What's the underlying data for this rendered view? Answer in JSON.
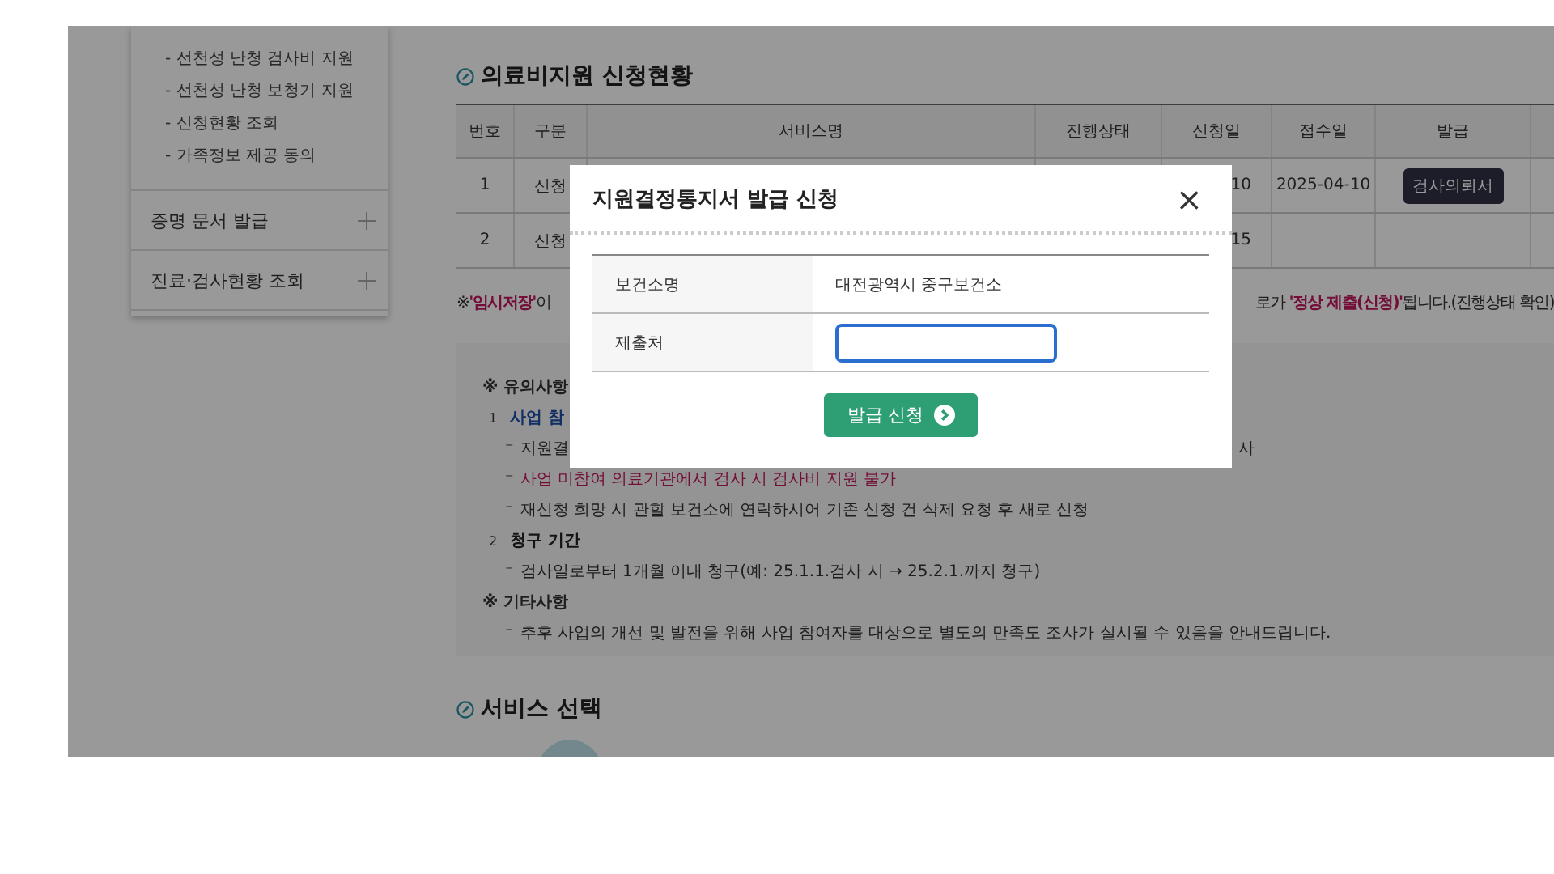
{
  "sidebar": {
    "sub_items": [
      "- 선천성 난청 검사비 지원",
      "- 선천성 난청 보청기 지원",
      "- 신청현황 조회",
      "- 가족정보 제공 동의"
    ],
    "sections": [
      {
        "label": "증명 문서 발급",
        "expanded": false
      },
      {
        "label": "진료·검사현황 조회",
        "expanded": false
      }
    ]
  },
  "status_section": {
    "title": "의료비지원 신청현황",
    "table": {
      "columns": [
        "번호",
        "구분",
        "서비스명",
        "진행상태",
        "신청일",
        "접수일",
        "발급"
      ],
      "rows": [
        {
          "cells": [
            "1",
            "신청",
            "",
            "",
            "10",
            "2025-04-10"
          ],
          "action": "검사의뢰서"
        },
        {
          "cells": [
            "2",
            "신청",
            "",
            "",
            "15",
            "",
            ""
          ]
        }
      ]
    },
    "notice_left": [
      {
        "text": "※",
        "em": false
      },
      {
        "text": "'임시저장'",
        "em": true
      },
      {
        "text": "이",
        "em": false
      }
    ],
    "notice_right": [
      {
        "text": "로가 ",
        "em": false
      },
      {
        "text": "'정상 제출(신청)'",
        "em": true
      },
      {
        "text": "됩니다.(진행상태 확인)",
        "em": false
      }
    ]
  },
  "notes": [
    {
      "kind": "heading",
      "text": "※ 유의사항"
    },
    {
      "kind": "numbered",
      "num": "1",
      "text": "사업 참",
      "em": true
    },
    {
      "kind": "bullet",
      "marker": "⁻",
      "text": "지원결",
      "tail": "사",
      "em": false
    },
    {
      "kind": "bullet",
      "marker": "⁻",
      "text": "사업 미참여 의료기관에서 검사 시 검사비 지원 불가",
      "em": true
    },
    {
      "kind": "bullet",
      "marker": "⁻",
      "text": "재신청 희망 시 관할 보건소에 연락하시어 기존 신청 건 삭제 요청 후 새로 신청",
      "em": false
    },
    {
      "kind": "numbered",
      "num": "2",
      "text": "청구 기간",
      "em": false
    },
    {
      "kind": "bullet",
      "marker": "⁻",
      "text": "검사일로부터 1개월 이내 청구(예: 25.1.1.검사 시 → 25.2.1.까지 청구)",
      "em": false
    },
    {
      "kind": "heading",
      "text": "※ 기타사항"
    },
    {
      "kind": "bullet",
      "marker": "⁻",
      "text": "추후 사업의 개선 및 발전을 위해 사업 참여자를 대상으로 별도의 만족도 조사가 실시될 수 있음을 안내드립니다.",
      "em": false
    }
  ],
  "service_section": {
    "title": "서비스 선택"
  },
  "modal": {
    "title": "지원결정통지서 발급 신청",
    "close": "×",
    "fields": [
      {
        "kind": "text",
        "label": "보건소명",
        "value": "대전광역시 중구보건소"
      },
      {
        "kind": "input",
        "label": "제출처",
        "focused": true
      }
    ],
    "submit": "발급 신청"
  }
}
